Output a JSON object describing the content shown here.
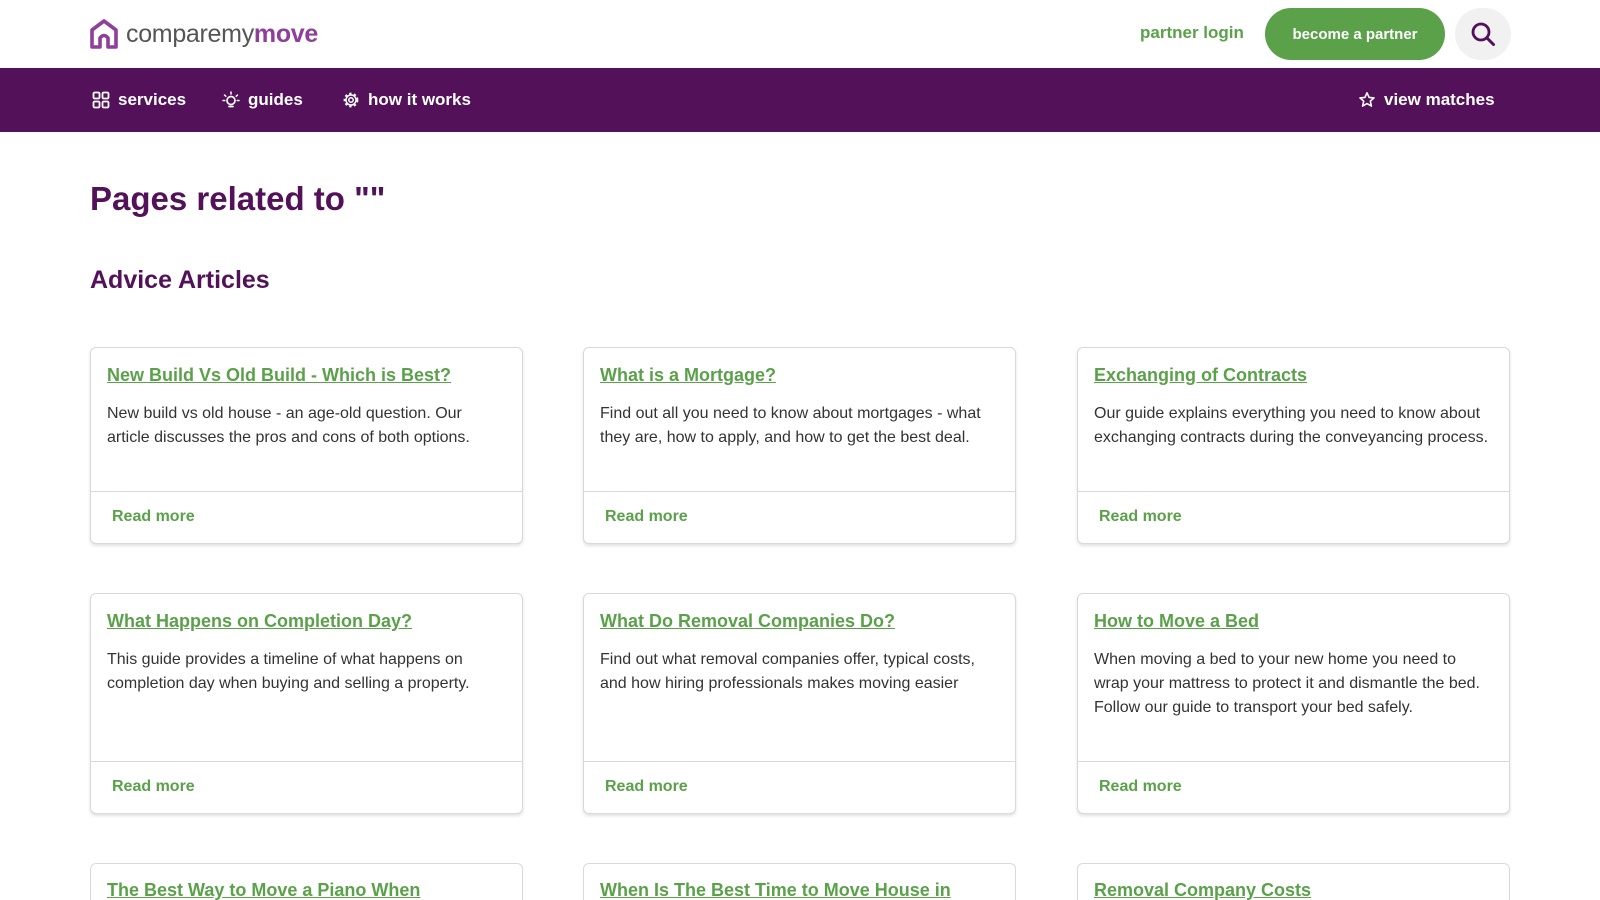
{
  "header": {
    "logo": {
      "part1": "comparemy",
      "part2": "move"
    },
    "partner_login": "partner login",
    "become_partner": "become a partner"
  },
  "nav": {
    "services": "services",
    "guides": "guides",
    "how_it_works": "how it works",
    "view_matches": "view matches"
  },
  "main": {
    "page_title": "Pages related to \"\"",
    "section_title": "Advice Articles",
    "articles": [
      {
        "title": "New Build Vs Old Build - Which is Best?",
        "description": "New build vs old house - an age-old question. Our article discusses the pros and cons of both options.",
        "link": "Read more"
      },
      {
        "title": "What is a Mortgage?",
        "description": "Find out all you need to know about mortgages - what they are, how to apply, and how to get the best deal.",
        "link": "Read more"
      },
      {
        "title": "Exchanging of Contracts",
        "description": "Our guide explains everything you need to know about exchanging contracts during the conveyancing process.",
        "link": "Read more"
      },
      {
        "title": "What Happens on Completion Day?",
        "description": "This guide provides a timeline of what happens on completion day when buying and selling a property.",
        "link": "Read more"
      },
      {
        "title": "What Do Removal Companies Do?",
        "description": "Find out what removal companies offer, typical costs, and how hiring professionals makes moving easier",
        "link": "Read more"
      },
      {
        "title": "How to Move a Bed",
        "description": "When moving a bed to your new home you need to wrap your mattress to protect it and dismantle the bed. Follow our guide to transport your bed safely.",
        "link": "Read more"
      },
      {
        "title": "The Best Way to Move a Piano When",
        "description": "",
        "link": ""
      },
      {
        "title": "When Is The Best Time to Move House in",
        "description": "",
        "link": ""
      },
      {
        "title": "Removal Company Costs",
        "description": "",
        "link": ""
      }
    ]
  },
  "colors": {
    "brand_purple": "#521158",
    "logo_purple": "#8e3f9a",
    "accent_green": "#5aa14a"
  },
  "icons": {
    "logo": "house-logo-icon",
    "search": "search-icon",
    "services": "grid-icon",
    "guides": "lightbulb-icon",
    "how_it_works": "gear-icon",
    "view_matches": "star-icon"
  }
}
